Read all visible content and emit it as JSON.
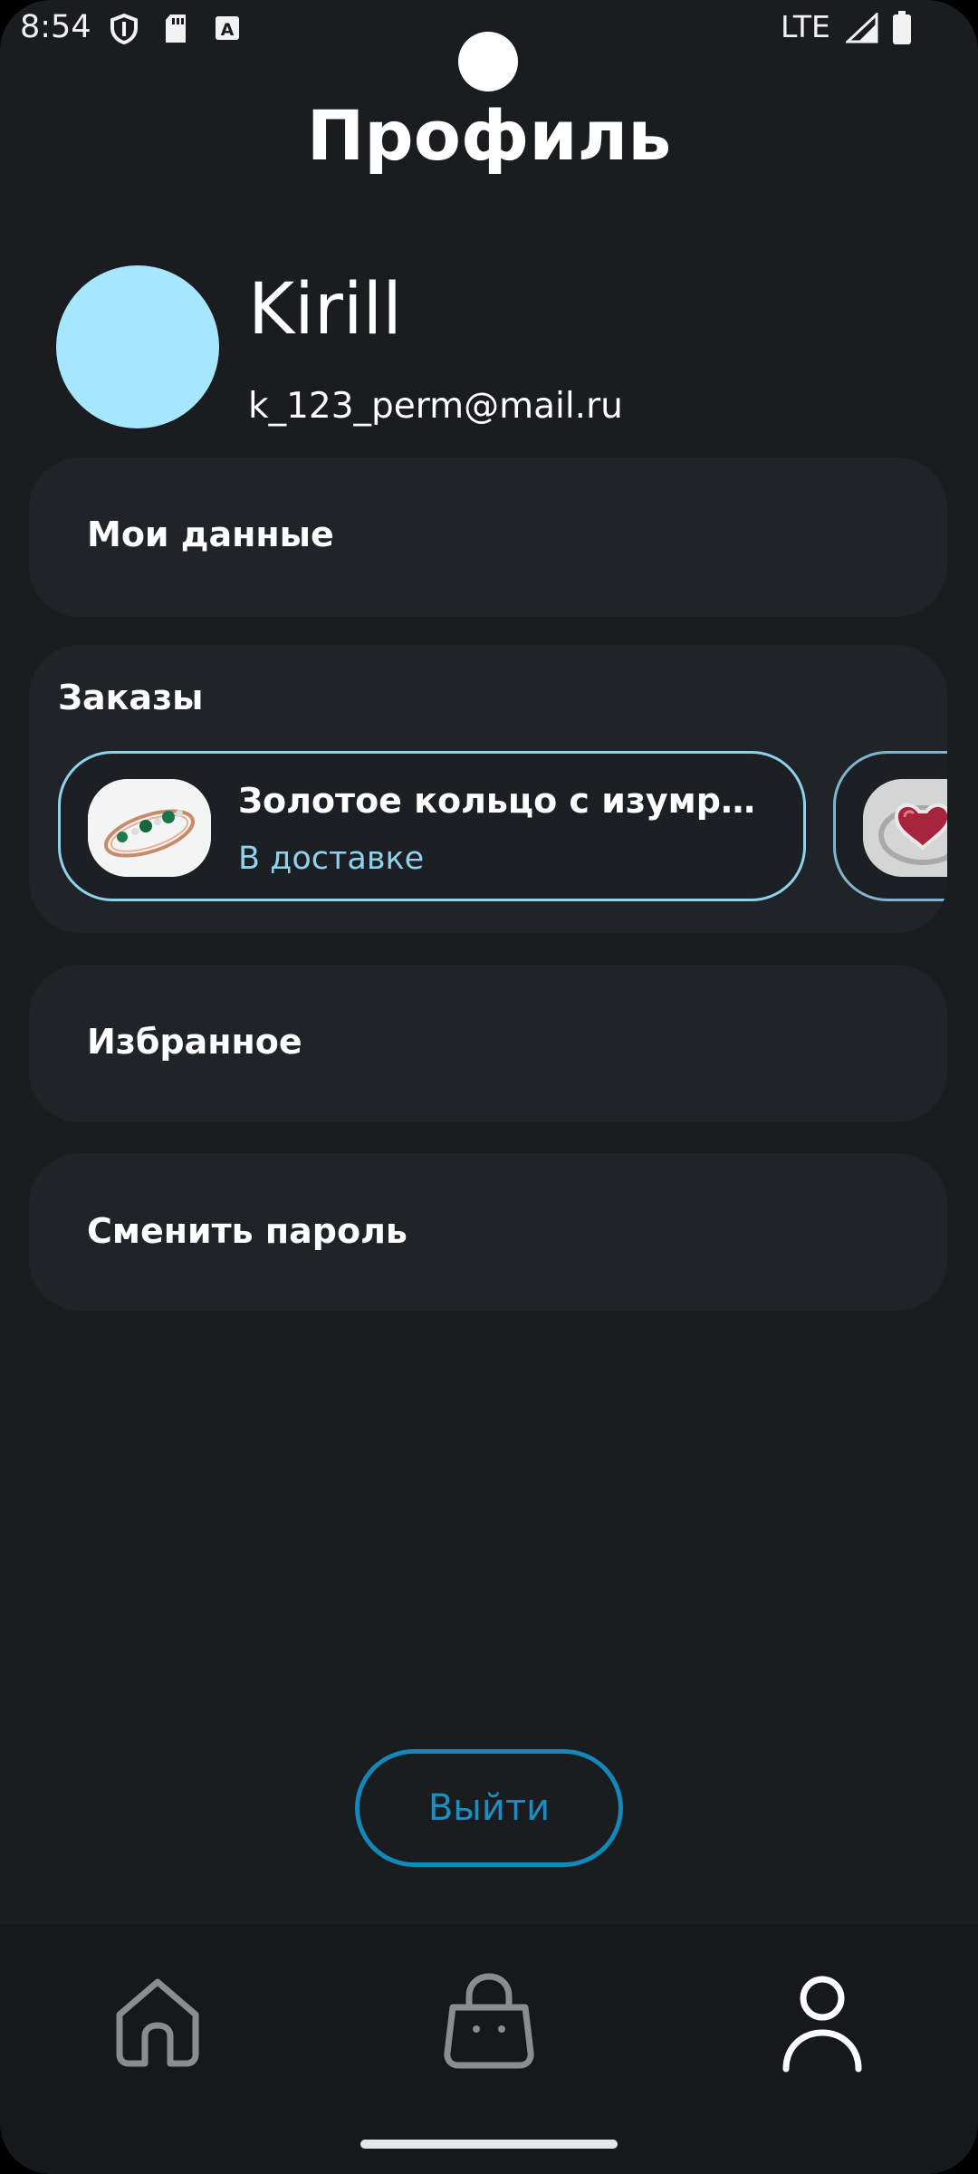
{
  "status_bar": {
    "time": "8:54",
    "network": "LTE",
    "icons": [
      "shield-icon",
      "sd-card-icon",
      "keyboard-a-icon",
      "signal-icon",
      "battery-icon"
    ]
  },
  "page": {
    "title": "Профиль"
  },
  "profile": {
    "name": "Kirill",
    "email": "k_123_perm@mail.ru",
    "avatar_color": "#a6e7ff"
  },
  "menu": {
    "my_data": "Мои данные",
    "orders_title": "Заказы",
    "favorites": "Избранное",
    "change_password": "Сменить пароль"
  },
  "orders": [
    {
      "name": "Золотое кольцо с изумру...",
      "status": "В доставке",
      "thumbnail": "emerald-ring-image"
    },
    {
      "name": "",
      "status": "",
      "thumbnail": "ruby-heart-ring-image"
    }
  ],
  "actions": {
    "logout": "Выйти"
  },
  "bottom_nav": {
    "items": [
      "home-icon",
      "shopping-bag-icon",
      "profile-icon"
    ],
    "active": "profile-icon"
  },
  "colors": {
    "background": "#1a1c20",
    "card": "#202328",
    "accent": "#8fd2ec",
    "logout": "#1287b8"
  }
}
